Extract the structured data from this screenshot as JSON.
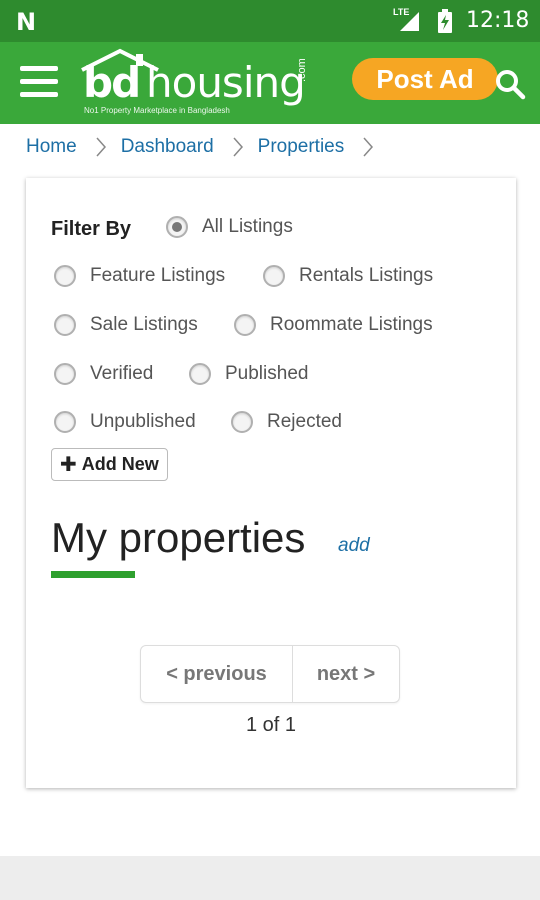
{
  "status_bar": {
    "time": "12:18",
    "network": "LTE",
    "notification_icon": "n-icon",
    "signal_icon": "signal-icon",
    "battery_icon": "battery-charging-icon"
  },
  "app_bar": {
    "logo_text_bold": "bd",
    "logo_text_light": "housing",
    "logo_suffix": ".com",
    "logo_tagline": "No1 Property Marketplace in Bangladesh",
    "post_ad_label": "Post Ad",
    "menu_icon": "hamburger-icon",
    "search_icon": "search-icon",
    "colors": {
      "bar": "#3aa83a",
      "status": "#2e8b2e",
      "post_ad": "#f6a623"
    }
  },
  "breadcrumb": {
    "items": [
      {
        "label": "Home"
      },
      {
        "label": "Dashboard"
      },
      {
        "label": "Properties"
      }
    ]
  },
  "filter": {
    "label": "Filter By",
    "options": [
      {
        "label": "All Listings",
        "checked": true
      },
      {
        "label": "Feature Listings",
        "checked": false
      },
      {
        "label": "Rentals Listings",
        "checked": false
      },
      {
        "label": "Sale Listings",
        "checked": false
      },
      {
        "label": "Roommate Listings",
        "checked": false
      },
      {
        "label": "Verified",
        "checked": false
      },
      {
        "label": "Published",
        "checked": false
      },
      {
        "label": "Unpublished",
        "checked": false
      },
      {
        "label": "Rejected",
        "checked": false
      }
    ],
    "add_new_label": "Add New"
  },
  "main": {
    "title": "My properties",
    "add_link": "add",
    "accent": "#2ea02e"
  },
  "pagination": {
    "previous_label": "< previous",
    "next_label": "next >",
    "page_info": "1 of 1"
  }
}
